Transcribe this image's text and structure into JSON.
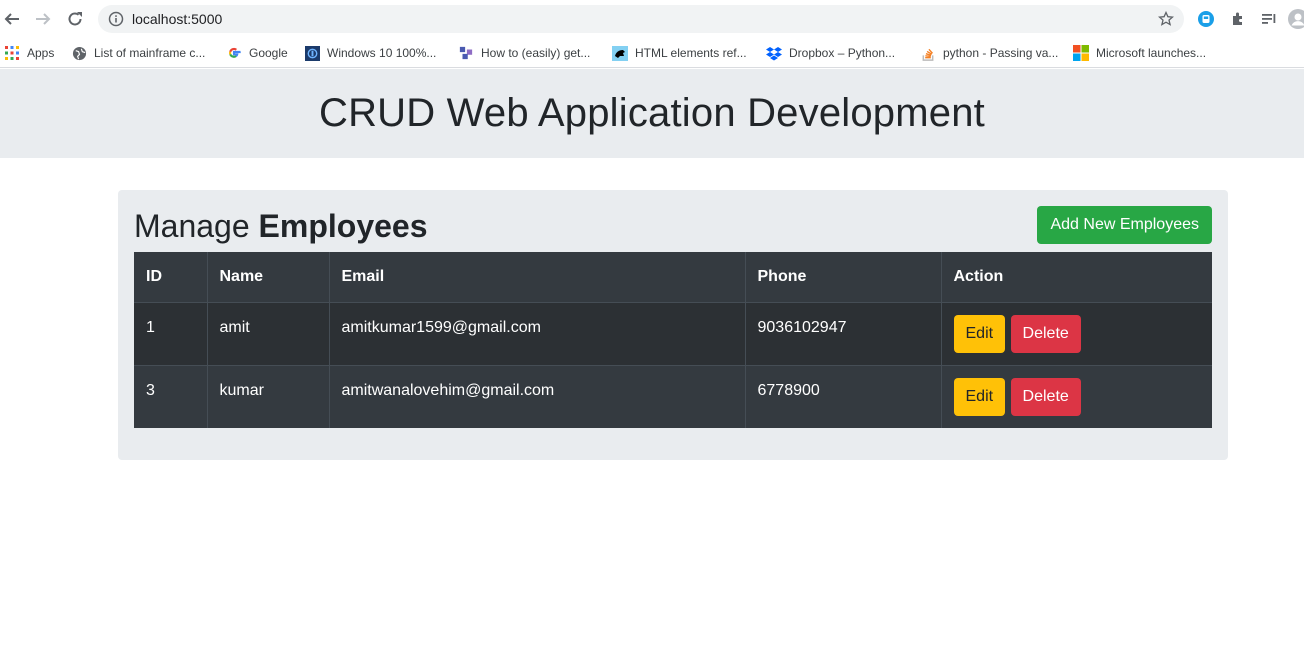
{
  "browser": {
    "url": "localhost:5000",
    "bookmarks": [
      {
        "label": "Apps",
        "icon": "apps-grid-icon"
      },
      {
        "label": "List of mainframe c...",
        "icon": "globe-icon"
      },
      {
        "label": "Google",
        "icon": "google-icon"
      },
      {
        "label": "Windows 10 100%...",
        "icon": "windows-site-icon"
      },
      {
        "label": "How to (easily) get...",
        "icon": "site-icon"
      },
      {
        "label": "HTML elements ref...",
        "icon": "mdn-icon"
      },
      {
        "label": "Dropbox – Python...",
        "icon": "dropbox-icon"
      },
      {
        "label": "python - Passing va...",
        "icon": "stackoverflow-icon"
      },
      {
        "label": "Microsoft launches...",
        "icon": "microsoft-icon"
      }
    ]
  },
  "page": {
    "header_title": "CRUD Web Application Development",
    "panel_title_prefix": "Manage",
    "panel_title_bold": "Employees",
    "add_button": "Add New Employees"
  },
  "table": {
    "columns": [
      "ID",
      "Name",
      "Email",
      "Phone",
      "Action"
    ],
    "rows": [
      {
        "id": "1",
        "name": "amit",
        "email": "amitkumar1599@gmail.com",
        "phone": "9036102947",
        "edit": "Edit",
        "delete": "Delete"
      },
      {
        "id": "3",
        "name": "kumar",
        "email": "amitwanalovehim@gmail.com",
        "phone": "6778900",
        "edit": "Edit",
        "delete": "Delete"
      }
    ]
  },
  "colors": {
    "jumbotron": "#e9ecef",
    "table_dark": "#343a40",
    "success": "#28a745",
    "warning": "#ffc107",
    "danger": "#dc3545"
  }
}
